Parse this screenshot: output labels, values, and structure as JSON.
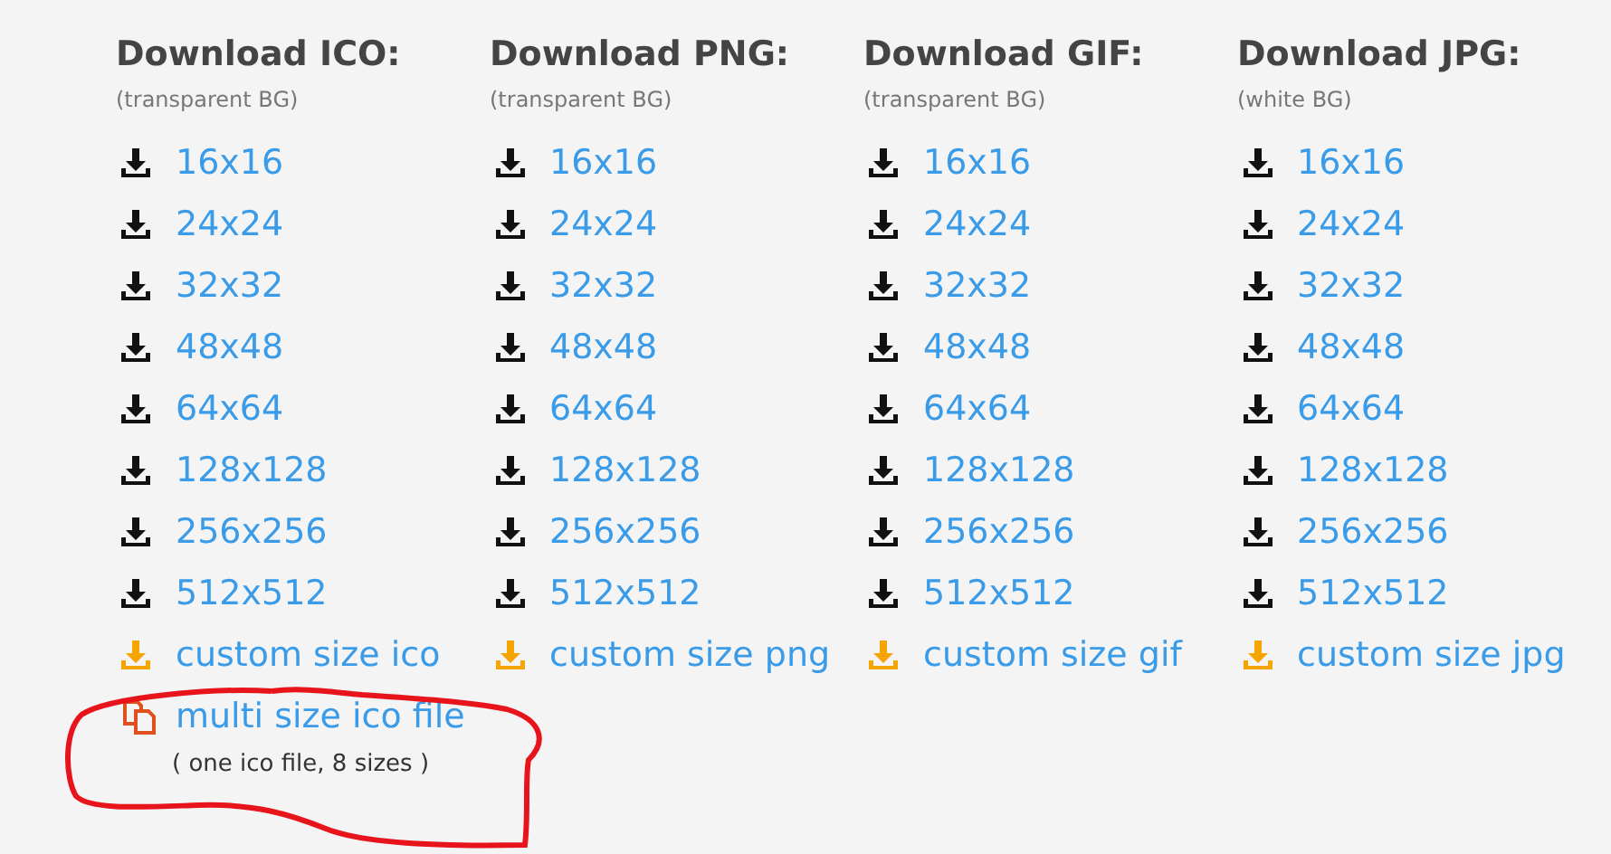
{
  "columns": [
    {
      "title": "Download ICO:",
      "note": "(transparent BG)",
      "links": [
        {
          "label": "16x16",
          "kind": "size"
        },
        {
          "label": "24x24",
          "kind": "size"
        },
        {
          "label": "32x32",
          "kind": "size"
        },
        {
          "label": "48x48",
          "kind": "size"
        },
        {
          "label": "64x64",
          "kind": "size"
        },
        {
          "label": "128x128",
          "kind": "size"
        },
        {
          "label": "256x256",
          "kind": "size"
        },
        {
          "label": "512x512",
          "kind": "size"
        },
        {
          "label": "custom size ico",
          "kind": "custom"
        }
      ],
      "multi": {
        "label": "multi size ico file",
        "note": "( one ico file, 8 sizes )"
      }
    },
    {
      "title": "Download PNG:",
      "note": "(transparent BG)",
      "links": [
        {
          "label": "16x16",
          "kind": "size"
        },
        {
          "label": "24x24",
          "kind": "size"
        },
        {
          "label": "32x32",
          "kind": "size"
        },
        {
          "label": "48x48",
          "kind": "size"
        },
        {
          "label": "64x64",
          "kind": "size"
        },
        {
          "label": "128x128",
          "kind": "size"
        },
        {
          "label": "256x256",
          "kind": "size"
        },
        {
          "label": "512x512",
          "kind": "size"
        },
        {
          "label": "custom size png",
          "kind": "custom"
        }
      ]
    },
    {
      "title": "Download GIF:",
      "note": "(transparent BG)",
      "links": [
        {
          "label": "16x16",
          "kind": "size"
        },
        {
          "label": "24x24",
          "kind": "size"
        },
        {
          "label": "32x32",
          "kind": "size"
        },
        {
          "label": "48x48",
          "kind": "size"
        },
        {
          "label": "64x64",
          "kind": "size"
        },
        {
          "label": "128x128",
          "kind": "size"
        },
        {
          "label": "256x256",
          "kind": "size"
        },
        {
          "label": "512x512",
          "kind": "size"
        },
        {
          "label": "custom size gif",
          "kind": "custom"
        }
      ]
    },
    {
      "title": "Download JPG:",
      "note": "(white BG)",
      "links": [
        {
          "label": "16x16",
          "kind": "size"
        },
        {
          "label": "24x24",
          "kind": "size"
        },
        {
          "label": "32x32",
          "kind": "size"
        },
        {
          "label": "48x48",
          "kind": "size"
        },
        {
          "label": "64x64",
          "kind": "size"
        },
        {
          "label": "128x128",
          "kind": "size"
        },
        {
          "label": "256x256",
          "kind": "size"
        },
        {
          "label": "512x512",
          "kind": "size"
        },
        {
          "label": "custom size jpg",
          "kind": "custom"
        }
      ]
    }
  ]
}
